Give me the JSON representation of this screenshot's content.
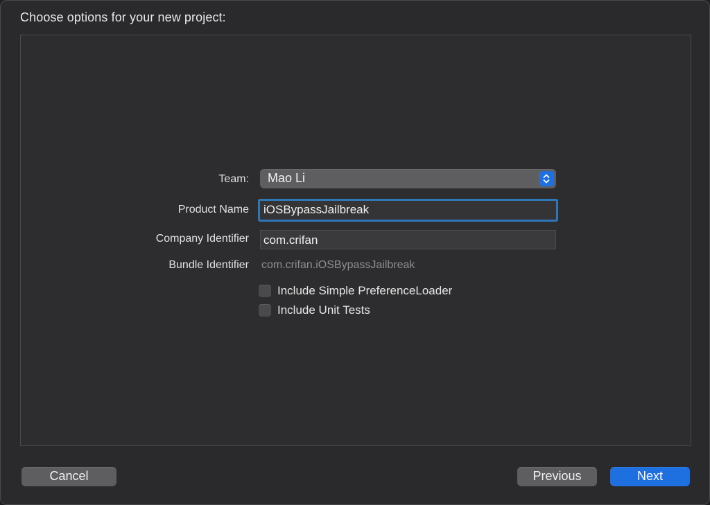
{
  "dialog": {
    "title": "Choose options for your new project:"
  },
  "form": {
    "team": {
      "label": "Team:",
      "value": "Mao Li"
    },
    "product_name": {
      "label": "Product Name",
      "value": "iOSBypassJailbreak"
    },
    "company_identifier": {
      "label": "Company Identifier",
      "value": "com.crifan"
    },
    "bundle_identifier": {
      "label": "Bundle Identifier",
      "value": "com.crifan.iOSBypassJailbreak"
    },
    "checkboxes": [
      {
        "label": "Include Simple PreferenceLoader",
        "checked": false
      },
      {
        "label": "Include Unit Tests",
        "checked": false
      }
    ]
  },
  "buttons": {
    "cancel": "Cancel",
    "previous": "Previous",
    "next": "Next"
  },
  "icons": {
    "popup_stepper": "up-down-chevron-icon"
  },
  "colors": {
    "accent": "#1e6fe0",
    "focus_ring": "#2e78b8"
  }
}
